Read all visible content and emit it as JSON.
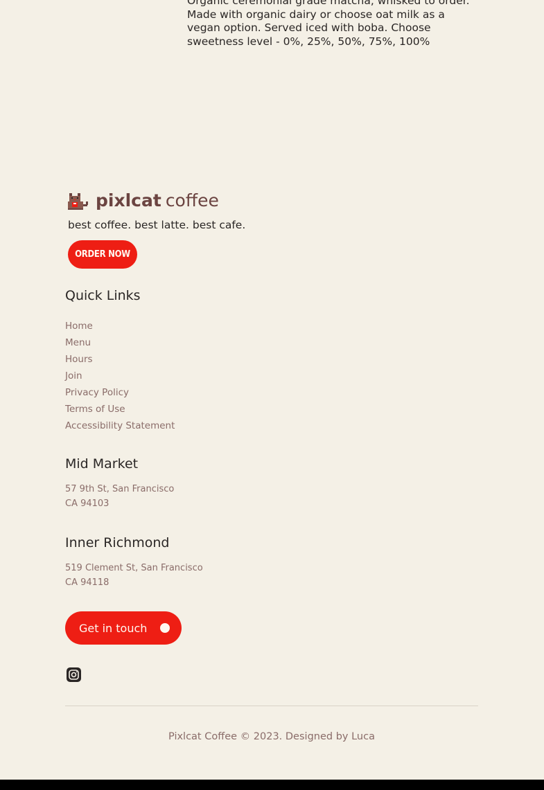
{
  "menu_item": {
    "description": "Organic ceremonial grade matcha, whisked to order. Made with organic dairy or choose oat milk as a vegan option. Served iced with boba. Choose sweetness level - 0%, 25%, 50%, 75%, 100%"
  },
  "footer": {
    "brand": {
      "icon": "pixel-cat-logo",
      "name_bold": "pixlcat",
      "name_light": "coffee"
    },
    "tagline": "best coffee. best latte. best cafe.",
    "order_button_label": "Order Now",
    "quick_links": {
      "title": "Quick Links",
      "items": [
        {
          "label": "Home"
        },
        {
          "label": "Menu"
        },
        {
          "label": "Hours"
        },
        {
          "label": "Join"
        },
        {
          "label": "Privacy Policy"
        },
        {
          "label": "Terms of Use"
        },
        {
          "label": "Accessibility Statement"
        }
      ]
    },
    "locations": [
      {
        "name": "Mid Market",
        "street": "57 9th St, San Francisco",
        "city": "CA 94103"
      },
      {
        "name": "Inner Richmond",
        "street": "519 Clement St, San Francisco",
        "city": "CA 94118"
      }
    ],
    "contact_button_label": "Get in touch",
    "social": [
      {
        "icon": "instagram-icon"
      }
    ],
    "copyright": "Pixlcat Coffee © 2023. Designed by Luca"
  },
  "colors": {
    "background": "#f4f0e6",
    "accent_red": "#ee1e14",
    "brand_brown": "#6b4441",
    "muted_text": "#8a6c69"
  }
}
